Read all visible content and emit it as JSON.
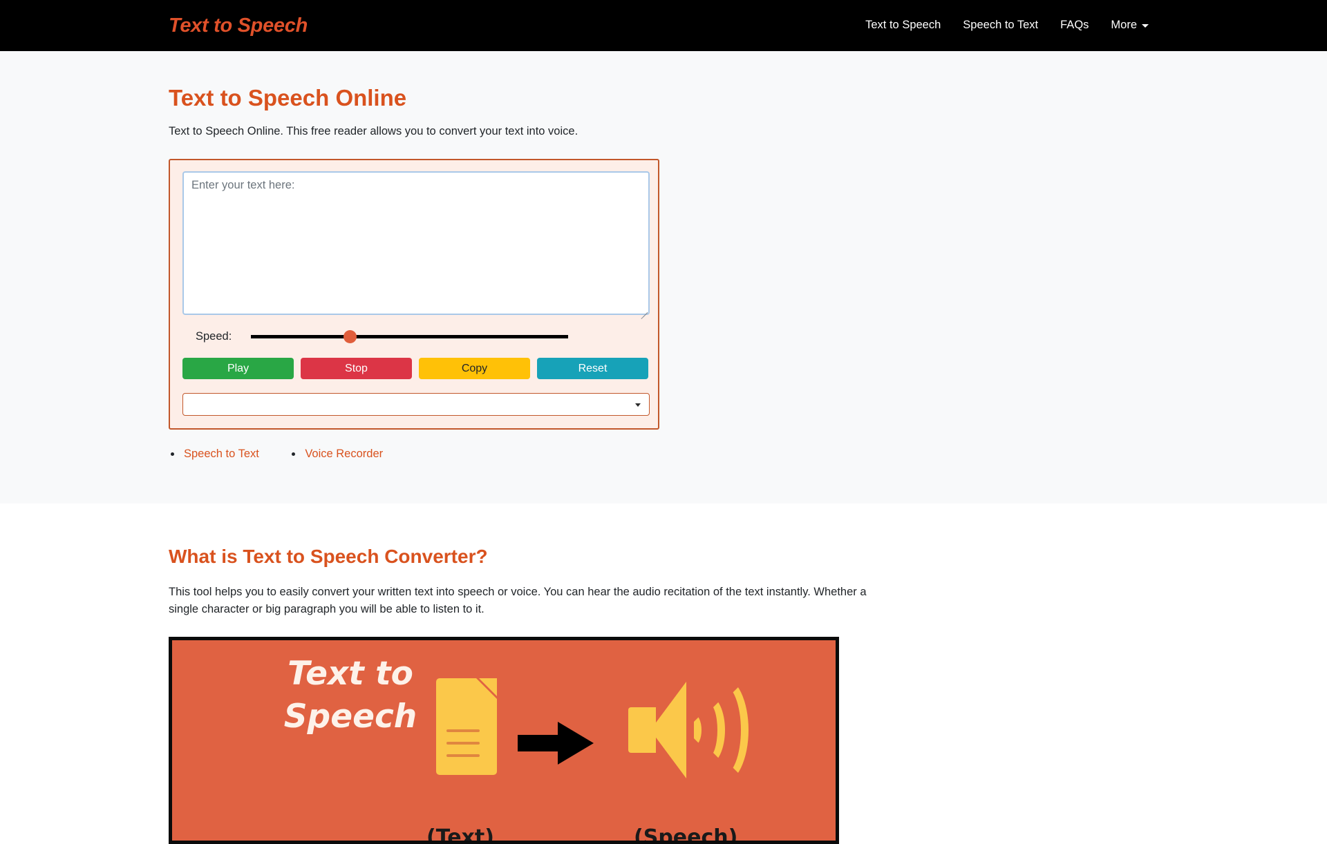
{
  "navbar": {
    "brand": "Text to Speech",
    "links": [
      {
        "label": "Text to Speech",
        "name": "nav-text-to-speech"
      },
      {
        "label": "Speech to Text",
        "name": "nav-speech-to-text"
      },
      {
        "label": "FAQs",
        "name": "nav-faqs"
      },
      {
        "label": "More",
        "name": "nav-more",
        "has_caret": true
      }
    ]
  },
  "hero": {
    "heading": "Text to Speech Online",
    "description": "Text to Speech Online. This free reader allows you to convert your text into voice."
  },
  "tool": {
    "textarea_placeholder": "Enter your text here:",
    "textarea_value": "",
    "speed_label": "Speed:",
    "speed_percent": 31,
    "buttons": [
      {
        "label": "Play",
        "color": "#29a745"
      },
      {
        "label": "Stop",
        "color": "#dc3546"
      },
      {
        "label": "Copy",
        "color": "#ffc107"
      },
      {
        "label": "Reset",
        "color": "#17a2b8"
      }
    ],
    "voice_select_value": "",
    "voice_select_options": [
      ""
    ]
  },
  "related_links": [
    {
      "label": "Speech to Text"
    },
    {
      "label": "Voice Recorder"
    }
  ],
  "about": {
    "heading": "What is Text to Speech Converter?",
    "paragraph": "This tool helps you to easily convert your written text into speech or voice. You can hear the audio recitation of the text instantly. Whether a single character or big paragraph you will be able to listen to it."
  },
  "banner": {
    "title": "Text to Speech",
    "label_text": "(Text)",
    "label_speech": "(Speech)",
    "background_color": "#e06242",
    "icon_color": "#fbc84a"
  },
  "colors": {
    "brand_orange": "#e0512a",
    "heading_orange": "#d9521e",
    "navbar_bg": "#000000",
    "section_bg": "#f8f9fa",
    "tool_bg": "#fdeee8",
    "tool_border": "#c2572a"
  }
}
